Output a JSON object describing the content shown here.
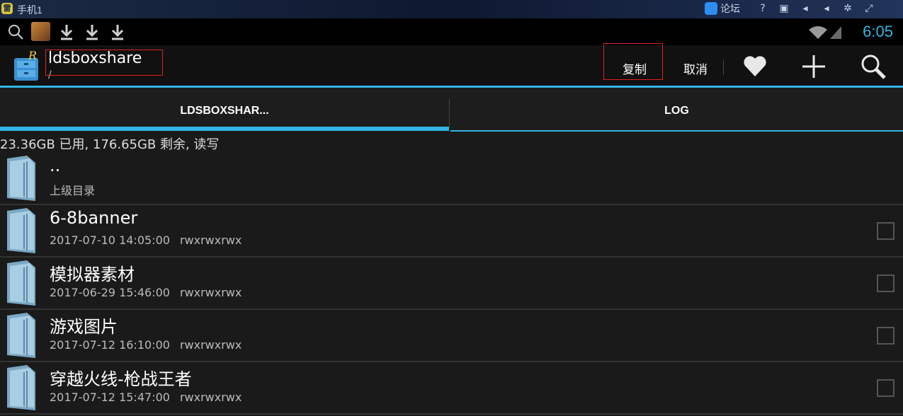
{
  "emulator": {
    "title": "手机1",
    "forum_label": "论坛"
  },
  "status_bar": {
    "time": "6:05",
    "icons": [
      "search-icon",
      "game-app-icon",
      "download-icon",
      "download-icon",
      "download-icon",
      "wifi-icon",
      "signal-icon"
    ]
  },
  "action_bar": {
    "title": "ldsboxshare",
    "subtitle": "/",
    "copy_label": "复制",
    "cancel_label": "取消"
  },
  "tabs": [
    {
      "label": "LDSBOXSHAR...",
      "active": true
    },
    {
      "label": "LOG",
      "active": false
    }
  ],
  "storage_info": "23.36GB 已用, 176.65GB 剩余, 读写",
  "files": [
    {
      "name": "..",
      "date": "",
      "perm": "",
      "subtitle": "上级目录"
    },
    {
      "name": "6-8banner",
      "date": "2017-07-10 14:05:00",
      "perm": "rwxrwxrwx"
    },
    {
      "name": "模拟器素材",
      "date": "2017-06-29 15:46:00",
      "perm": "rwxrwxrwx"
    },
    {
      "name": "游戏图片",
      "date": "2017-07-12 16:10:00",
      "perm": "rwxrwxrwx"
    },
    {
      "name": "穿越火线-枪战王者",
      "date": "2017-07-12 15:47:00",
      "perm": "rwxrwxrwx"
    }
  ],
  "colors": {
    "accent": "#33b5e5",
    "highlight_box": "#e02020"
  }
}
